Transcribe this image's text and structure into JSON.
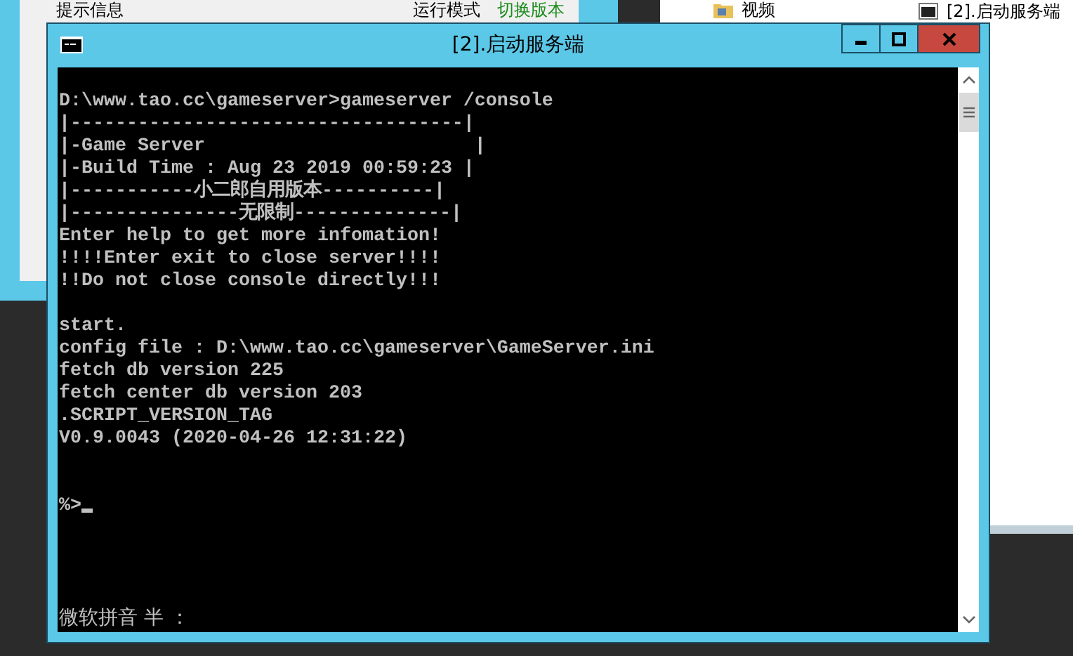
{
  "background_window": {
    "labels": [
      {
        "text": "提示信息",
        "kind": "label"
      },
      {
        "text": "运行模式",
        "kind": "label"
      },
      {
        "text": "切换版本",
        "kind": "link"
      }
    ]
  },
  "explorer": {
    "items": [
      {
        "label": "视频",
        "kind": "folder"
      },
      {
        "label": "[2].启动服务端",
        "kind": "console"
      }
    ]
  },
  "console_window": {
    "title": "[2].启动服务端",
    "blocks": [
      [
        "D:\\www.tao.cc\\gameserver>gameserver /console",
        "|-----------------------------------|",
        "|-Game Server                        |",
        "|-Build Time : Aug 23 2019 00:59:23 |",
        "|-----------小二郎自用版本----------|",
        "|---------------无限制--------------|",
        "Enter help to get more infomation!",
        "!!!!Enter exit to close server!!!!",
        "!!Do not close console directly!!!"
      ],
      [
        "start.",
        "config file : D:\\www.tao.cc\\gameserver\\GameServer.ini",
        "fetch db version 225",
        "fetch center db version 203",
        ".SCRIPT_VERSION_TAG",
        "V0.9.0043 (2020-04-26 12:31:22)"
      ]
    ],
    "prompt": "%>",
    "ime_status": "微软拼音 半 ："
  }
}
